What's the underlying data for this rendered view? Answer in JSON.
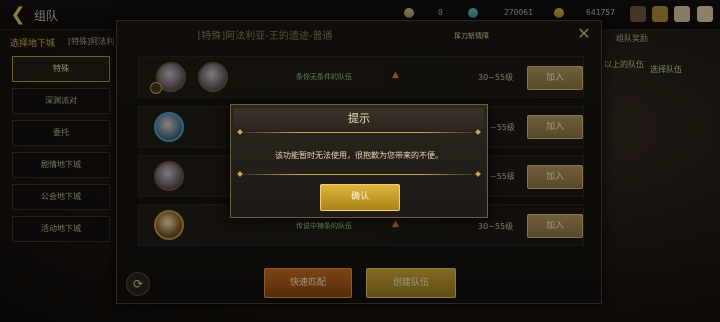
{
  "header": {
    "back_icon": "back-arrow-icon",
    "title": "组队",
    "currency": [
      "0",
      "270061",
      "641757"
    ]
  },
  "sidebar": {
    "title": "选择地下城",
    "subtitle": "[特殊]阿法利",
    "items": [
      {
        "label": "特殊",
        "active": true
      },
      {
        "label": "深渊派对",
        "active": false
      },
      {
        "label": "委托",
        "active": false
      },
      {
        "label": "剧情地下城",
        "active": false
      },
      {
        "label": "公会地下城",
        "active": false
      },
      {
        "label": "活动地下城",
        "active": false
      }
    ]
  },
  "right": {
    "help": "组队奖励",
    "hint": "以上的队伍",
    "select": "选择队伍"
  },
  "panel": {
    "title": "[特殊]阿法利亚-王的遗迹-普通",
    "badge": "挥刀斩情障",
    "close_icon": "close-icon",
    "rows": [
      {
        "text": "条你无条件的队伍",
        "level": "30~55级",
        "join": "加入"
      },
      {
        "text": "",
        "level": "~55级",
        "join": "加入"
      },
      {
        "text": "",
        "level": "~55级",
        "join": "加入"
      },
      {
        "text": "传说中辣条的队伍",
        "level": "30~55级",
        "join": "加入"
      }
    ],
    "quick_match": "快速匹配",
    "create_team": "创建队伍"
  },
  "dialog": {
    "title": "提示",
    "message": "该功能暂时无法使用，很抱歉为您带来的不便。",
    "confirm": "确认"
  }
}
